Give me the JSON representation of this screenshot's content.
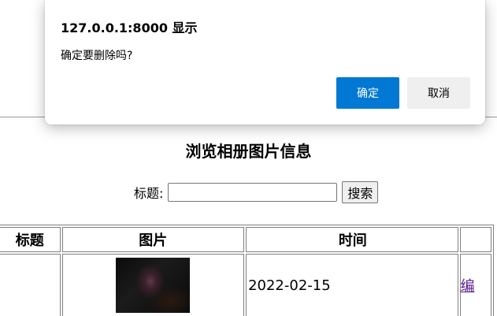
{
  "dialog": {
    "title": "127.0.0.1:8000 显示",
    "message": "确定要删除吗?",
    "ok_label": "确定",
    "cancel_label": "取消",
    "ok_color": "#0078d4"
  },
  "page": {
    "title": "浏览相册图片信息",
    "search": {
      "label": "标题:",
      "value": "",
      "button_label": "搜索"
    }
  },
  "table": {
    "headers": [
      "标题",
      "图片",
      "时间"
    ],
    "rows": [
      {
        "title": "",
        "time": "2022-02-15",
        "op": "编"
      }
    ]
  }
}
